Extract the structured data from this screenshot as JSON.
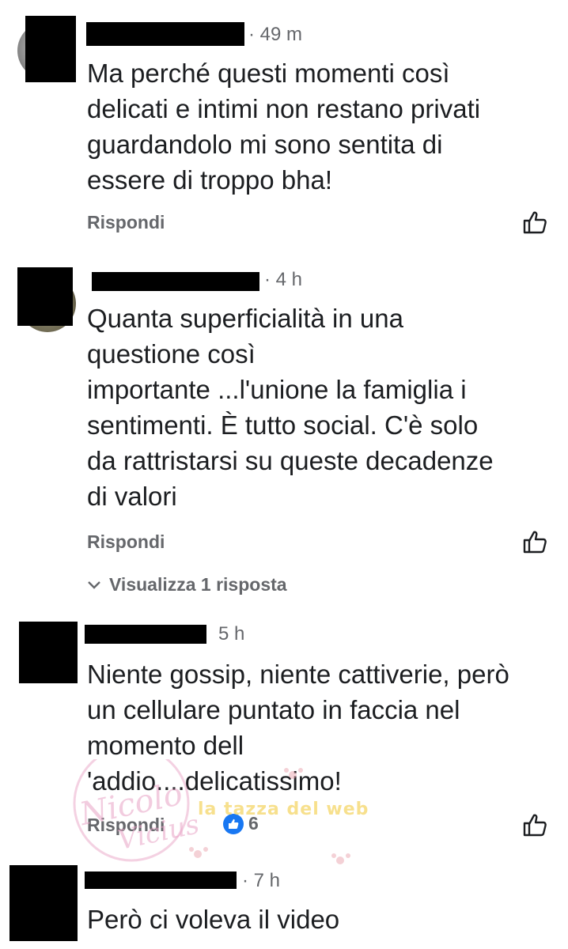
{
  "comments": [
    {
      "time": "· 49 m",
      "text": "Ma perché questi momenti così\ndelicati e intimi non restano privati\nguardandolo mi sono sentita di\nessere di troppo bha!",
      "reply_label": "Rispondi"
    },
    {
      "time": "· 4 h",
      "text": "Quanta superficialità in  una\nquestione così\nimportante ...l'unione la famiglia i\nsentimenti. È tutto social. C'è solo\nda rattristarsi su queste decadenze\ndi valori",
      "reply_label": "Rispondi",
      "view_replies": "Visualizza 1 risposta"
    },
    {
      "time": "5 h",
      "text": "Niente gossip, niente cattiverie, però\nun cellulare puntato in faccia nel\nmomento dell\n'addio....delicatissimo!",
      "reply_label": "Rispondi",
      "reactions_count": "6"
    },
    {
      "time": "· 7 h",
      "text": "Però ci voleva il video"
    }
  ],
  "watermark": {
    "name": "Nicolo Vicius",
    "site": "la tazza del web"
  },
  "icons": {
    "like": "thumbs-up-outline-icon",
    "chevron": "chevron-down-icon",
    "reaction": "like-reaction-icon"
  },
  "colors": {
    "text": "#1c1e21",
    "secondary": "#65676b",
    "reaction_blue": "#1877f2",
    "watermark_pink": "#e9a3c6"
  }
}
